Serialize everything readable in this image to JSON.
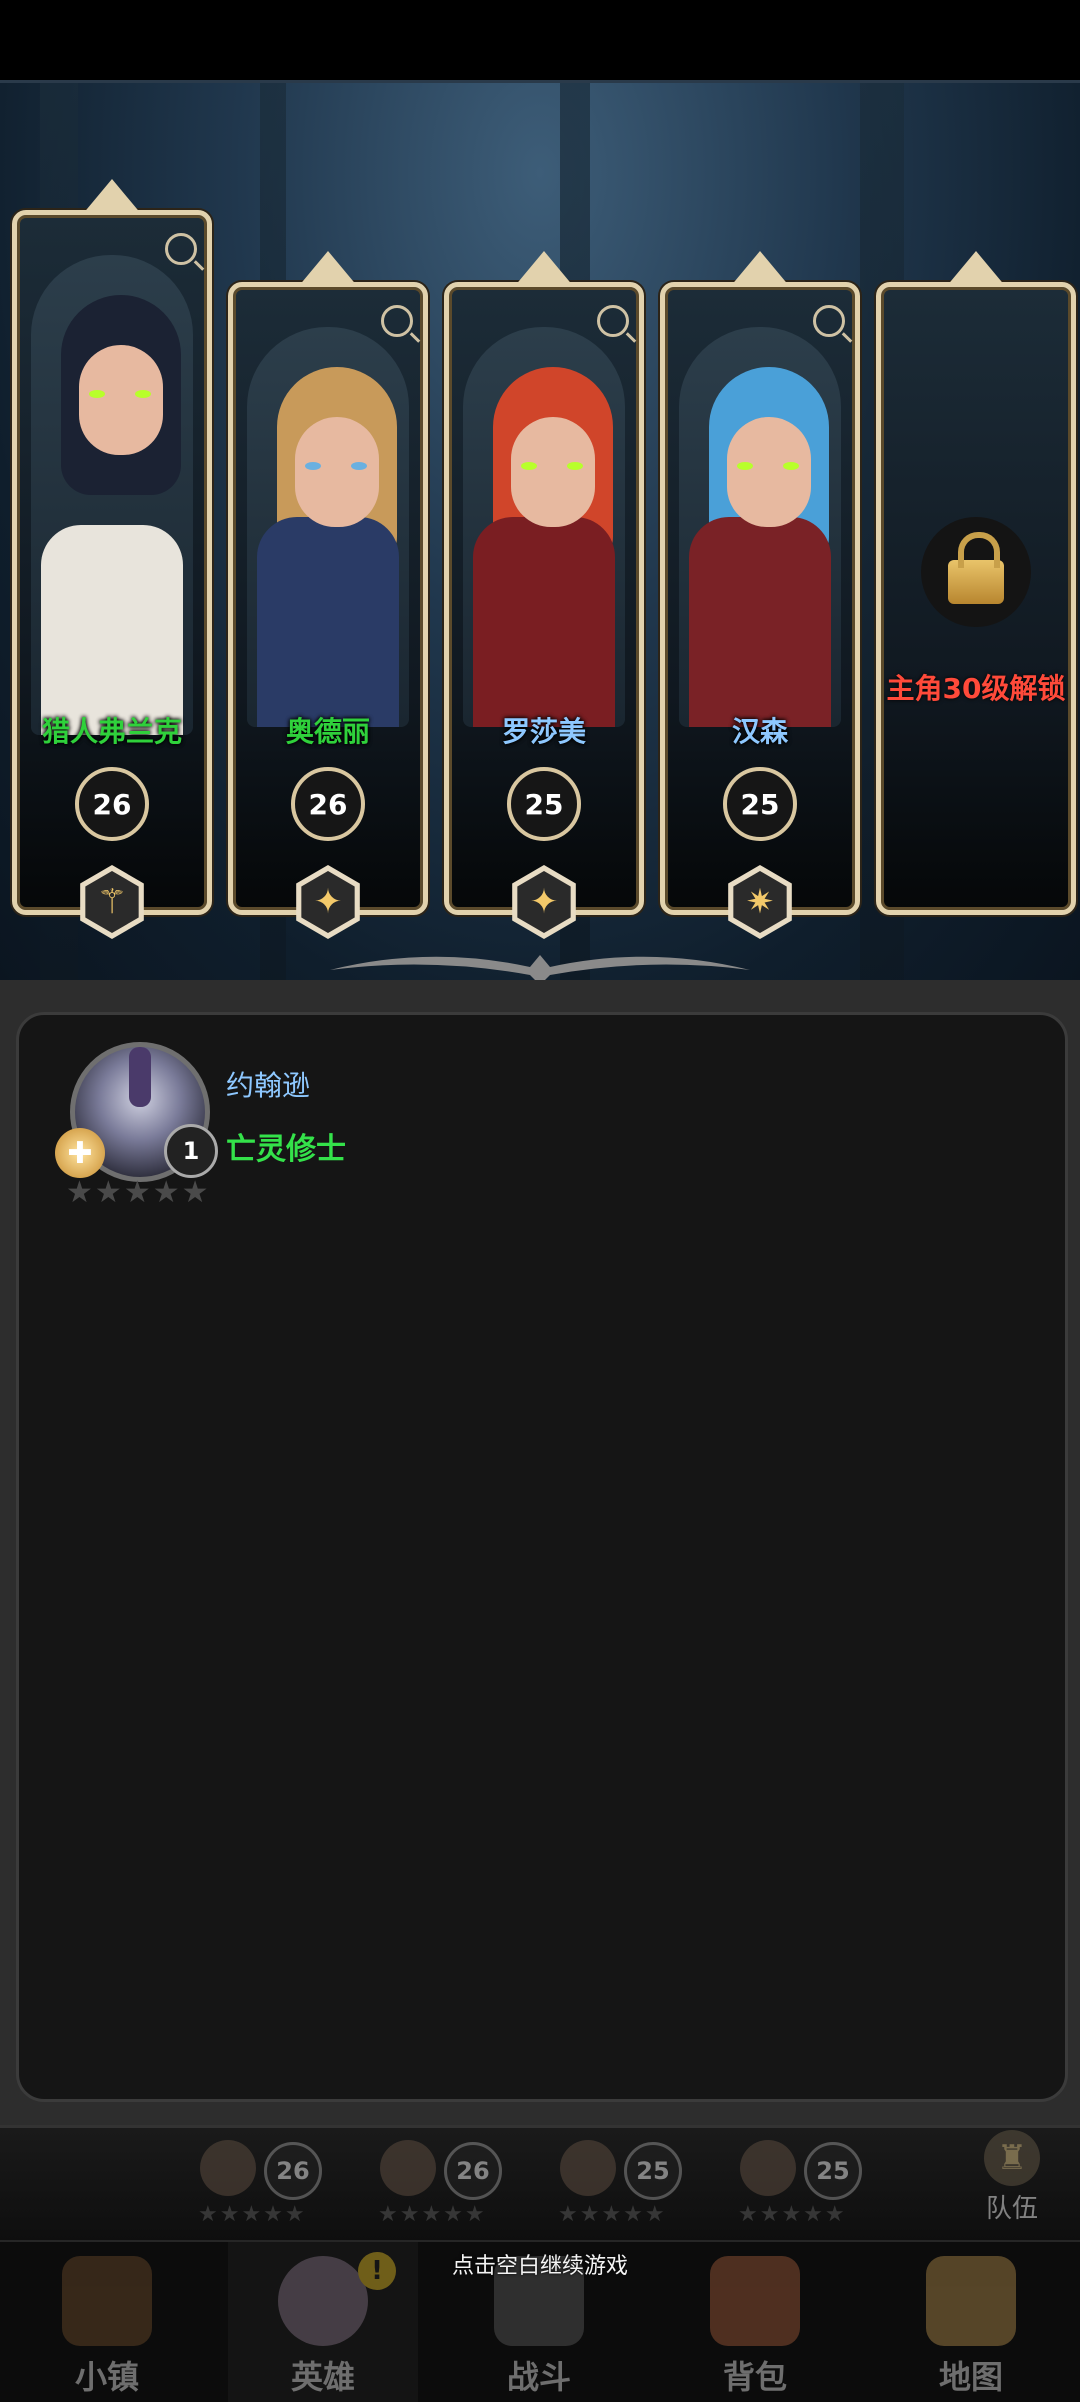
{
  "party": [
    {
      "name": "猎人弗兰克",
      "level": "26",
      "name_color": "#2fd13b",
      "hair": "#1b2233",
      "outfit": "#e8e4dc",
      "icon": "staff-icon",
      "icon_glyph": "⚚"
    },
    {
      "name": "奥德丽",
      "level": "26",
      "name_color": "#2fd13b",
      "hair": "#c89a5a",
      "outfit": "#2a3b66",
      "icon": "holy-star-icon",
      "icon_glyph": "✦"
    },
    {
      "name": "罗莎美",
      "level": "25",
      "name_color": "#8ec8ff",
      "hair": "#d0452a",
      "outfit": "#7a1e22",
      "icon": "holy-star-icon",
      "icon_glyph": "✦"
    },
    {
      "name": "汉森",
      "level": "25",
      "name_color": "#8ec8ff",
      "hair": "#4aa0d8",
      "outfit": "#7a2226",
      "icon": "radiant-star-icon",
      "icon_glyph": "✷"
    }
  ],
  "locked_slot": {
    "text": "主角30级解锁",
    "icon": "padlock-icon"
  },
  "member": {
    "name": "约翰逊",
    "class": "亡灵修士",
    "level": "1",
    "stars": [
      "★",
      "★",
      "★",
      "★",
      "★"
    ],
    "class_icon": "holy-cross-icon",
    "class_glyph": "✚"
  },
  "roster": [
    {
      "level": "26",
      "stars": "★★★★★"
    },
    {
      "level": "26",
      "stars": "★★★★★"
    },
    {
      "level": "25",
      "stars": "★★★★★"
    },
    {
      "level": "25",
      "stars": "★★★★★"
    }
  ],
  "team_button": {
    "label": "队伍",
    "icon": "chess-pieces-icon",
    "glyph": "♜"
  },
  "nav": [
    {
      "label": "小镇",
      "icon": "town-icon"
    },
    {
      "label": "英雄",
      "icon": "hero-icon"
    },
    {
      "label": "战斗",
      "icon": "crossed-swords-icon"
    },
    {
      "label": "背包",
      "icon": "backpack-icon"
    },
    {
      "label": "地图",
      "icon": "map-icon"
    }
  ],
  "nav_alert": "!",
  "toast": "点击空白继续游戏",
  "colors": {
    "gold_frame": "#e2d2ad",
    "locked_text": "#ff4a3a",
    "class_text": "#34e24a",
    "name_text": "#8ec8ff"
  }
}
